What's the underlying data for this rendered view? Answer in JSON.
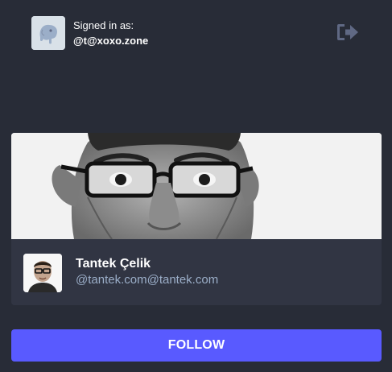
{
  "session": {
    "signed_in_label": "Signed in as:",
    "account": "@t@xoxo.zone",
    "avatar_icon": "mastodon-elephant-icon",
    "logout_icon": "sign-out-icon"
  },
  "profile": {
    "display_name": "Tantek Çelik",
    "acct": "@tantek.com@tantek.com"
  },
  "actions": {
    "follow_label": "FOLLOW"
  },
  "colors": {
    "background": "#282c37",
    "card": "#313543",
    "accent": "#595aff",
    "muted_text": "#9baec8"
  }
}
